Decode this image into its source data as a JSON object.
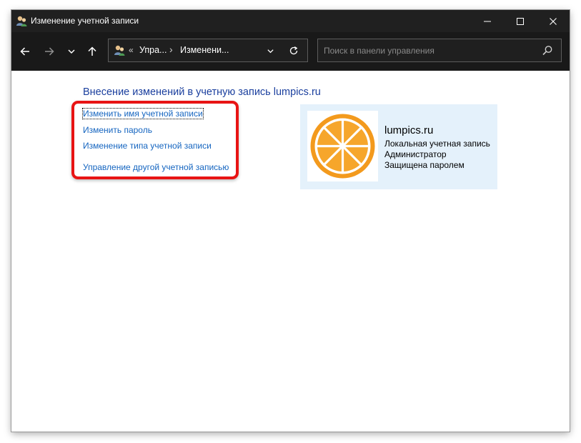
{
  "window": {
    "title": "Изменение учетной записи",
    "accent": "#202020"
  },
  "titlebar_controls": {
    "minimize_icon": "minimize-icon",
    "maximize_icon": "maximize-icon",
    "close_icon": "close-icon"
  },
  "navigation": {
    "back_icon": "arrow-left-icon",
    "forward_icon": "arrow-right-icon",
    "recent_icon": "chevron-down-icon",
    "up_icon": "arrow-up-icon"
  },
  "address_bar": {
    "overflow": "«",
    "crumbs": [
      "Упра...",
      "Изменени..."
    ],
    "separator": "›",
    "dropdown_icon": "chevron-down-icon",
    "refresh_icon": "refresh-icon"
  },
  "search": {
    "placeholder": "Поиск в панели управления",
    "value": "",
    "icon": "search-icon"
  },
  "main": {
    "heading": "Внесение изменений в учетную запись lumpics.ru",
    "tasks": [
      "Изменить имя учетной записи",
      "Изменить пароль",
      "Изменение типа учетной записи",
      "Управление другой учетной записью"
    ],
    "highlight_color": "#e81414",
    "link_color": "#1565c0"
  },
  "account": {
    "name": "lumpics.ru",
    "type": "Локальная учетная запись",
    "role": "Администратор",
    "protection": "Защищена паролем",
    "avatar": "orange-slice-avatar",
    "card_color": "#e4f1fb"
  }
}
